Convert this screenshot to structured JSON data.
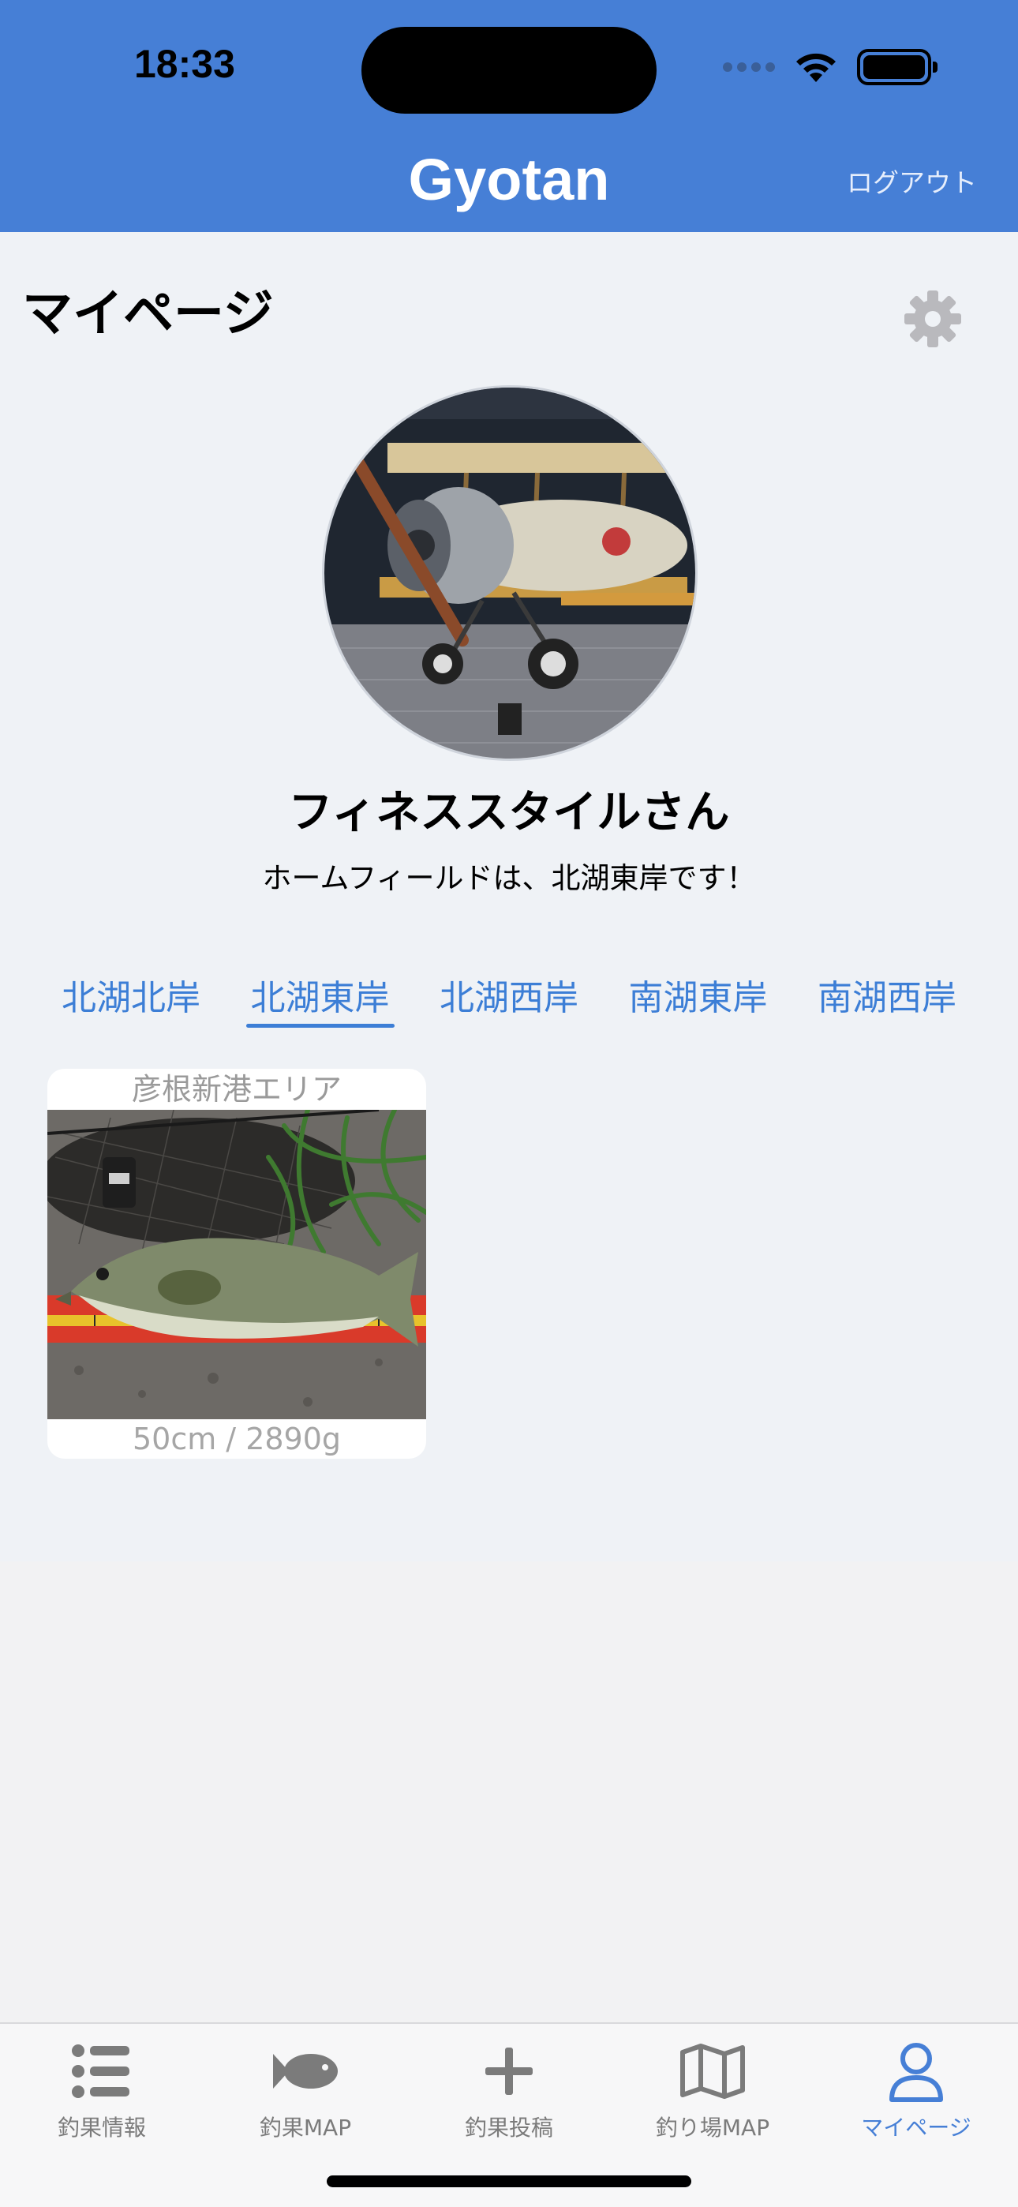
{
  "status_bar": {
    "time": "18:33"
  },
  "header": {
    "title": "Gyotan",
    "logout_label": "ログアウト"
  },
  "page": {
    "title": "マイページ"
  },
  "profile": {
    "name": "フィネススタイルさん",
    "home_field": "ホームフィールドは、北湖東岸です！"
  },
  "area_tabs": [
    {
      "label": "北湖北岸",
      "active": false
    },
    {
      "label": "北湖東岸",
      "active": true
    },
    {
      "label": "北湖西岸",
      "active": false
    },
    {
      "label": "南湖東岸",
      "active": false
    },
    {
      "label": "南湖西岸",
      "active": false
    }
  ],
  "catches": [
    {
      "area": "彦根新港エリア",
      "size": "50cm / 2890g"
    }
  ],
  "tab_bar": [
    {
      "label": "釣果情報",
      "icon": "list-icon",
      "active": false
    },
    {
      "label": "釣果MAP",
      "icon": "fish-icon",
      "active": false
    },
    {
      "label": "釣果投稿",
      "icon": "plus-icon",
      "active": false
    },
    {
      "label": "釣り場MAP",
      "icon": "map-icon",
      "active": false
    },
    {
      "label": "マイページ",
      "icon": "user-icon",
      "active": true
    }
  ],
  "colors": {
    "header": "#467fd6",
    "accent": "#3c7ed6",
    "inactive": "#7b7b7b"
  }
}
